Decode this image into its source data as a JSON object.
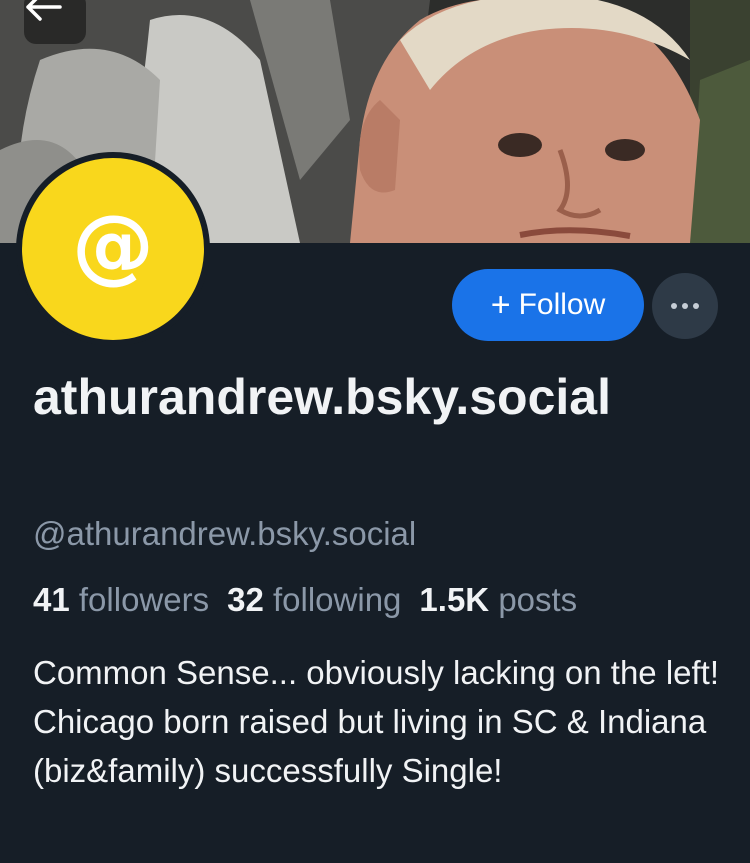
{
  "header": {
    "back_icon": "arrow-left-icon",
    "banner_description_icon": "banner-photo"
  },
  "avatar": {
    "symbol": "@",
    "background_color": "#f9d71c"
  },
  "actions": {
    "follow_plus": "+",
    "follow_label": "Follow",
    "follow_color": "#1a73e8",
    "more_icon": "ellipsis-icon"
  },
  "profile": {
    "display_name": "athurandrew.bsky.social",
    "handle": "@athurandrew.bsky.social",
    "followers_count": "41",
    "followers_label": "followers",
    "following_count": "32",
    "following_label": "following",
    "posts_count": "1.5K",
    "posts_label": "posts",
    "bio": "Common Sense... obviously lacking on the left!  Chicago born raised but living in SC & Indiana (biz&family) successfully Single!"
  }
}
